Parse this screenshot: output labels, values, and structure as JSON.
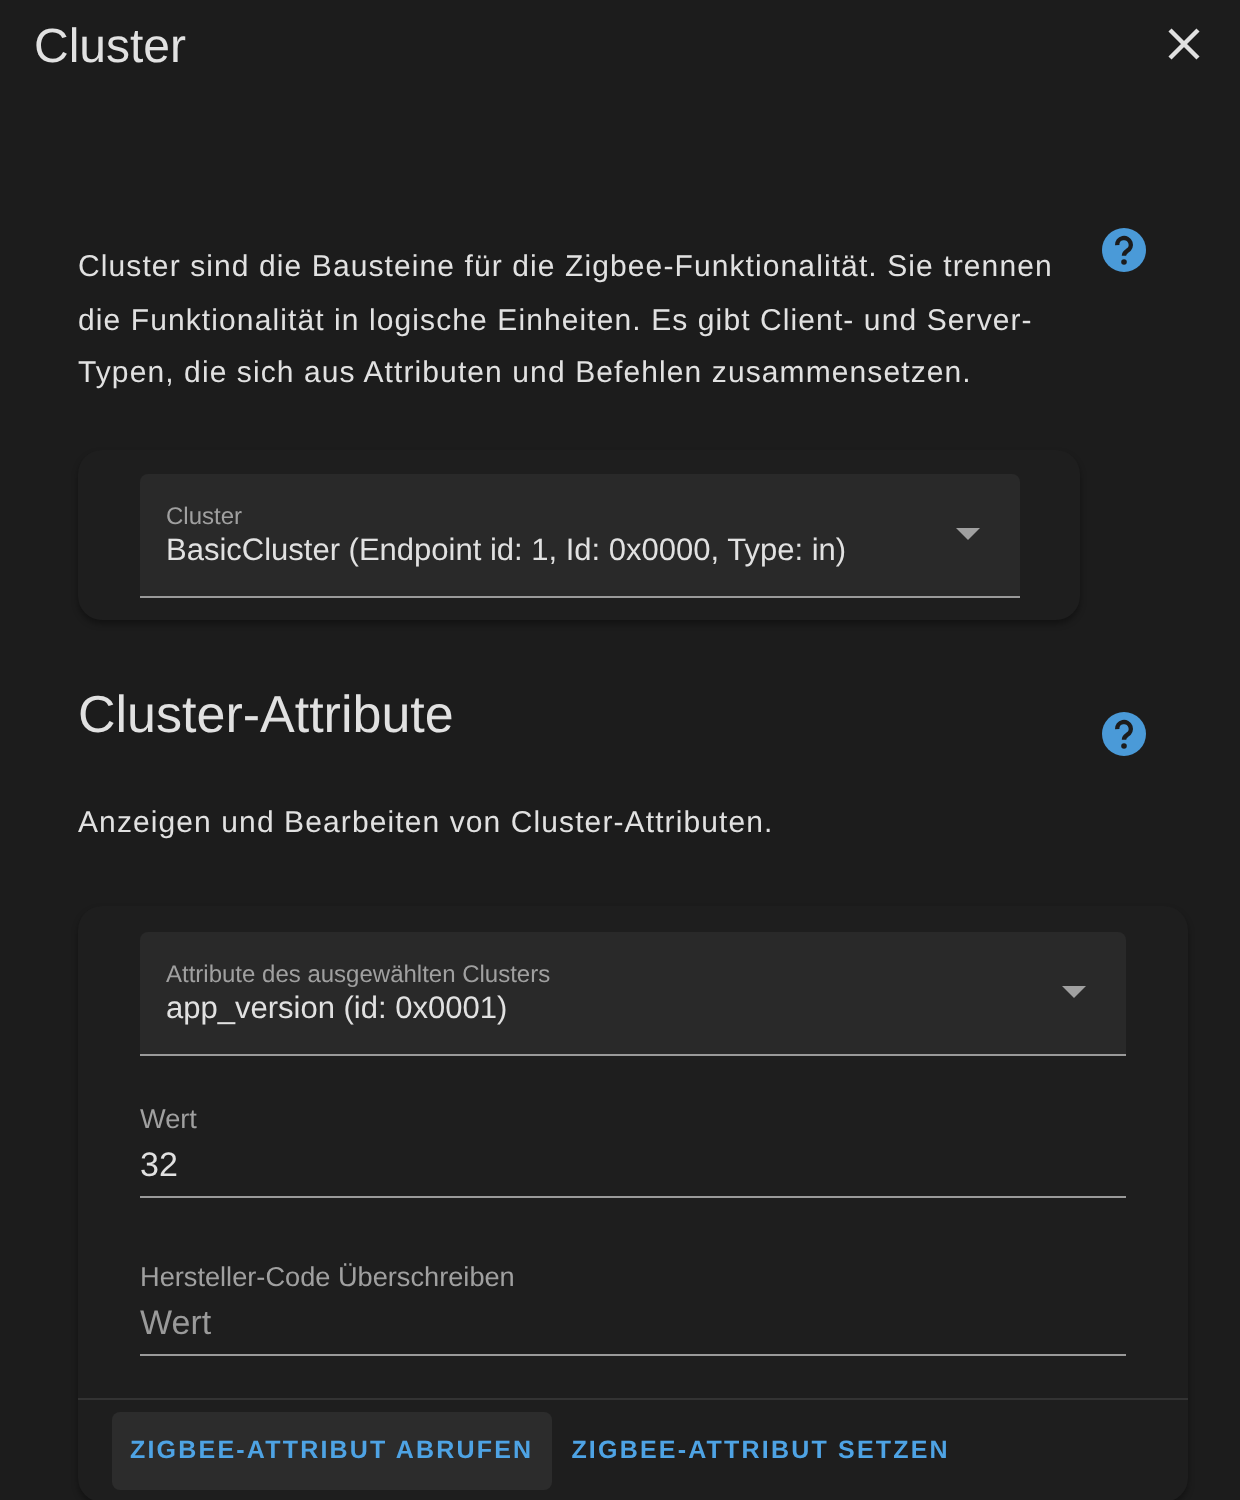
{
  "dialog": {
    "title": "Cluster"
  },
  "cluster_section": {
    "description": "Cluster sind die Bausteine für die Zigbee-Funktionalität. Sie trennen die Funktionalität in logische Einheiten. Es gibt Client- und Server-Typen, die sich aus Attributen und Befehlen zusammensetzen.",
    "cluster_select": {
      "label": "Cluster",
      "value": "BasicCluster (Endpoint id: 1, Id: 0x0000, Type: in)"
    }
  },
  "attributes_section": {
    "heading": "Cluster-Attribute",
    "description": "Anzeigen und Bearbeiten von Cluster-Attributen.",
    "attribute_select": {
      "label": "Attribute des ausgewählten Clusters",
      "value": "app_version (id: 0x0001)"
    },
    "fields": [
      {
        "label": "Wert",
        "value": "32"
      },
      {
        "label": "Hersteller-Code Überschreiben",
        "placeholder": "Wert"
      }
    ],
    "buttons": [
      {
        "label": "ZIGBEE-ATTRIBUT ABRUFEN",
        "focused": true
      },
      {
        "label": "ZIGBEE-ATTRIBUT SETZEN",
        "focused": false
      }
    ]
  }
}
